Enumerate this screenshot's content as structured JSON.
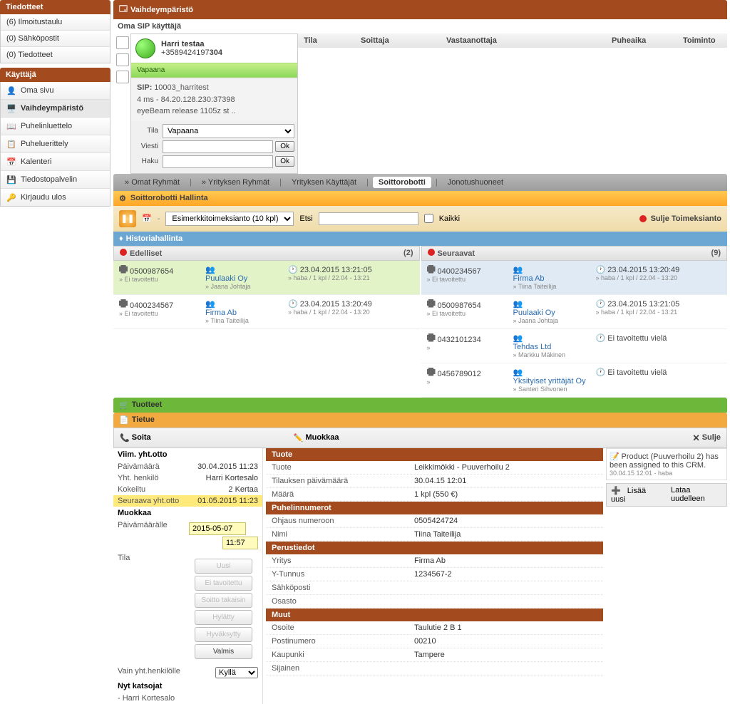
{
  "sidebar": {
    "tiedotteet_hdr": "Tiedotteet",
    "tiedotteet_items": [
      "(6) Ilmoitustaulu",
      "(0) Sähköpostit",
      "(0) Tiedotteet"
    ],
    "kayttaja_hdr": "Käyttäjä",
    "kayttaja_items": [
      "Oma sivu",
      "Vaihdeympäristö",
      "Puhelinluettelo",
      "Puheluerittely",
      "Kalenteri",
      "Tiedostopalvelin",
      "Kirjaudu ulos"
    ]
  },
  "env_hdr": "Vaihdeympäristö",
  "sip_title": "Oma SIP käyttäjä",
  "sip": {
    "name": "Harri testaa",
    "num_prefix": "+3589424197",
    "num_bold": "304",
    "status": "Vapaana",
    "sip_lbl": "SIP:",
    "sip_id": "10003_harritest",
    "ping": "4 ms - 84.20.128.230:37398",
    "client": "eyeBeam release 1105z st ..",
    "tila_lbl": "Tila",
    "tila_val": "Vapaana",
    "viesti_lbl": "Viesti",
    "haku_lbl": "Haku",
    "ok": "Ok"
  },
  "call_cols": {
    "tila": "Tila",
    "soittaja": "Soittaja",
    "vast": "Vastaanottaja",
    "puhe": "Puheaika",
    "toim": "Toiminto"
  },
  "tabs": {
    "omat": "Omat Ryhmät",
    "yrit": "Yrityksen Ryhmät",
    "kayt": "Yrityksen Käyttäjät",
    "robo": "Soittorobotti",
    "jono": "Jonotushuoneet"
  },
  "robo_hdr": "Soittorobotti Hallinta",
  "toolbar": {
    "assign": "Esimerkkitoimeksianto (10 kpl)",
    "etsi": "Etsi",
    "kaikki": "Kaikki",
    "sulje": "Sulje Toimeksianto"
  },
  "hist_hdr": "Historiahallinta",
  "edelliset": "Edelliset",
  "edelliset_cnt": "(2)",
  "seuraavat": "Seuraavat",
  "seuraavat_cnt": "(9)",
  "prev_rows": [
    {
      "num": "0500987654",
      "sub": "Ei tavoitettu",
      "org": "Puulaaki Oy",
      "person": "Jaana Johtaja",
      "time": "23.04.2015 13:21:05",
      "meta": "haba / 1 kpl / 22.04 - 13:21"
    },
    {
      "num": "0400234567",
      "sub": "Ei tavoitettu",
      "org": "Firma Ab",
      "person": "Tiina Taiteilija",
      "time": "23.04.2015 13:20:49",
      "meta": "haba / 1 kpl / 22.04 - 13:20"
    }
  ],
  "next_rows": [
    {
      "num": "0400234567",
      "sub": "Ei tavoitettu",
      "org": "Firma Ab",
      "person": "Tiina Taiteilija",
      "time": "23.04.2015 13:20:49",
      "meta": "haba / 1 kpl / 22.04 - 13:20"
    },
    {
      "num": "0500987654",
      "sub": "Ei tavoitettu",
      "org": "Puulaaki Oy",
      "person": "Jaana Johtaja",
      "time": "23.04.2015 13:21:05",
      "meta": "haba / 1 kpl / 22.04 - 13:21"
    },
    {
      "num": "0432101234",
      "sub": "",
      "org": "Tehdas Ltd",
      "person": "Markku Mäkinen",
      "status": "Ei tavoitettu vielä"
    },
    {
      "num": "0456789012",
      "sub": "",
      "org": "Yksityiset yrittäjät Oy",
      "person": "Santeri Sihvonen",
      "status": "Ei tavoitettu vielä"
    }
  ],
  "tuotteet_hdr": "Tuotteet",
  "tietue_hdr": "Tietue",
  "soita_hdr": "Soita",
  "muokkaa_hdr": "Muokkaa",
  "sulje_btn": "Sulje",
  "contact": {
    "viim": "Viim. yht.otto",
    "pvm_l": "Päivämäärä",
    "pvm_v": "30.04.2015 11:23",
    "yht_l": "Yht. henkilö",
    "yht_v": "Harri Kortesalo",
    "kok_l": "Kokeiltu",
    "kok_v": "2 Kertaa",
    "seur_l": "Seuraava yht.otto",
    "seur_v": "01.05.2015 11:23",
    "muok": "Muokkaa",
    "pvml_l": "Päivämäärälle",
    "pvml_d": "2015-05-07",
    "pvml_t": "11:57",
    "tila_l": "Tila",
    "btns": [
      "Uusi",
      "Ei tavoitettu",
      "Soitto takaisin",
      "Hylätty",
      "Hyväksytty",
      "Valmis"
    ],
    "vain_l": "Vain yht.henkilölle",
    "vain_v": "Kyllä",
    "nyt": "Nyt katsojat",
    "viewer": "- Harri Kortesalo"
  },
  "detail": {
    "tuote_hdr": "Tuote",
    "tuote_l": "Tuote",
    "tuote_v": "Leikkimökki - Puuverhoilu 2",
    "til_l": "Tilauksen päivämäärä",
    "til_v": "30.04.15 12:01",
    "maara_l": "Määrä",
    "maara_v": "1 kpl (550 €)",
    "puh_hdr": "Puhelinnumerot",
    "ohj_l": "Ohjaus numeroon",
    "ohj_v": "0505424724",
    "nimi_l": "Nimi",
    "nimi_v": "Tiina Taiteilija",
    "perus_hdr": "Perustiedot",
    "yr_l": "Yritys",
    "yr_v": "Firma Ab",
    "yt_l": "Y-Tunnus",
    "yt_v": "1234567-2",
    "sp_l": "Sähköposti",
    "os_l": "Osasto",
    "muut_hdr": "Muut",
    "oso_l": "Osoite",
    "oso_v": "Taulutie 2 B 1",
    "pn_l": "Postinumero",
    "pn_v": "00210",
    "kau_l": "Kaupunki",
    "kau_v": "Tampere",
    "sij_l": "Sijainen"
  },
  "notif": {
    "text": "Product (Puuverhoilu 2) has been assigned to this CRM.",
    "ts": "30.04.15 12:01 - haba",
    "add": "Lisää uusi",
    "reload": "Lataa uudelleen"
  }
}
